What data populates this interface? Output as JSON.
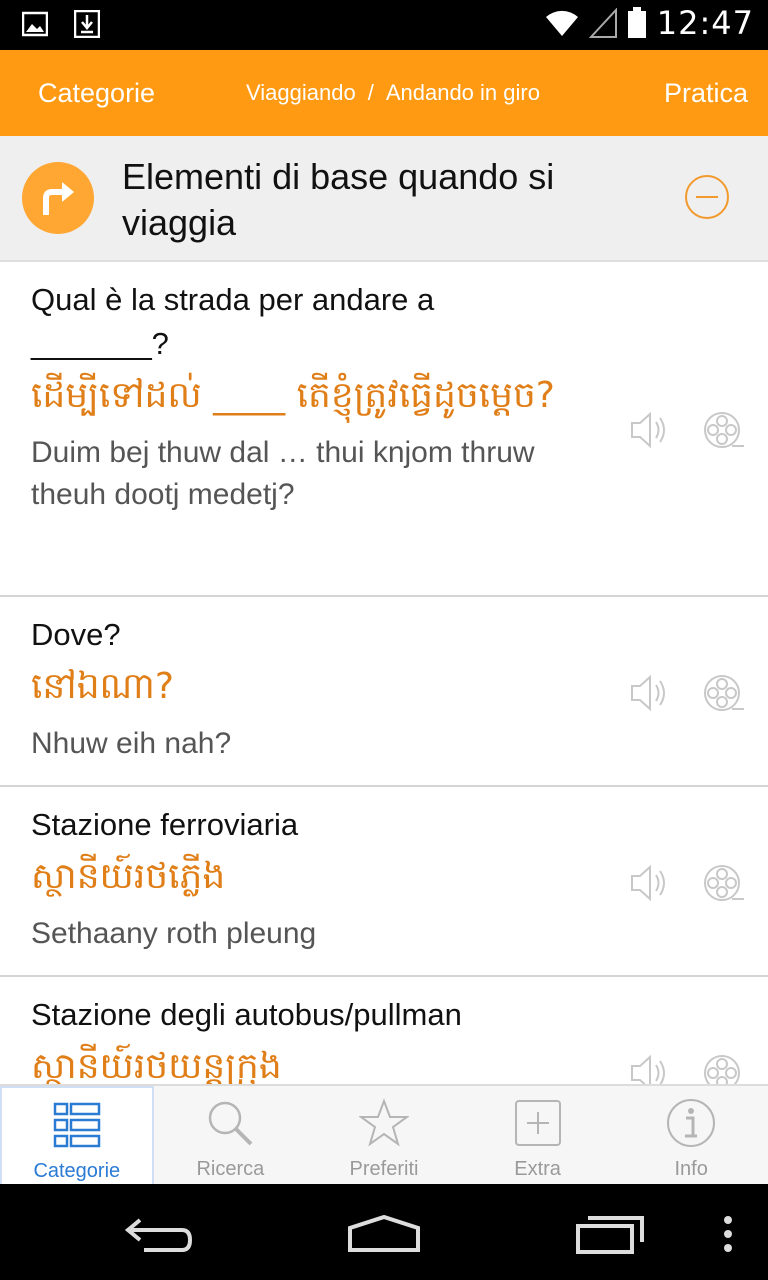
{
  "status": {
    "time": "12:47"
  },
  "header": {
    "left": "Categorie",
    "breadcrumb": [
      "Viaggiando",
      "Andando in giro"
    ],
    "separator": "/",
    "right": "Pratica"
  },
  "category": {
    "title": "Elementi di base quando si viaggia"
  },
  "items": [
    {
      "native": "Qual è la strada per andare a _______?",
      "foreign": "ដើម្បីទៅដល់ ____ តើខ្ញុំត្រូវធ្វើដូចម្តេច?",
      "roman": "Duim bej thuw dal … thui knjom thruw theuh dootj medetj?"
    },
    {
      "native": "Dove?",
      "foreign": "នៅឯណា?",
      "roman": "Nhuw eih nah?"
    },
    {
      "native": "Stazione ferroviaria",
      "foreign": "ស្ថានីយ៍រថភ្លើង",
      "roman": "Sethaany roth pleung"
    },
    {
      "native": "Stazione degli autobus/pullman",
      "foreign": "ស្ថានីយ៍រថយន្តក្រុង",
      "roman": ""
    }
  ],
  "tabs": [
    "Categorie",
    "Ricerca",
    "Preferiti",
    "Extra",
    "Info"
  ],
  "colors": {
    "accent": "#ff9a12",
    "foreign_text": "#e07e18",
    "active_tab": "#2a7bd4"
  }
}
